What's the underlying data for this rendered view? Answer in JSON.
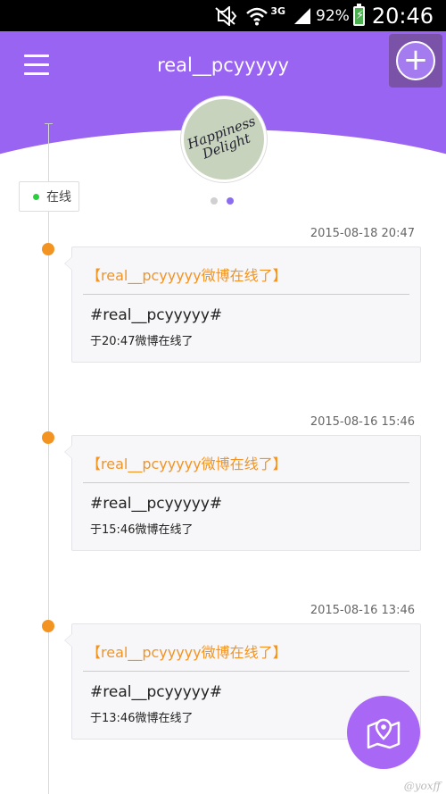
{
  "status_bar": {
    "network_type": "3G",
    "battery_percent": "92%",
    "time": "20:46"
  },
  "header": {
    "title": "real__pcyyyyy",
    "avatar_text": "Happiness Delight",
    "carousel": {
      "pages": 2,
      "active": 2
    }
  },
  "online_status": {
    "label": "在线",
    "color": "#2ecc40"
  },
  "timeline": {
    "entries": [
      {
        "timestamp": "2015-08-18 20:47",
        "title": "【real__pcyyyyy微博在线了】",
        "tag": "#real__pcyyyyy#",
        "body": "于20:47微博在线了"
      },
      {
        "timestamp": "2015-08-16 15:46",
        "title": "【real__pcyyyyy微博在线了】",
        "tag": "#real__pcyyyyy#",
        "body": "于15:46微博在线了"
      },
      {
        "timestamp": "2015-08-16 13:46",
        "title": "【real__pcyyyyy微博在线了】",
        "tag": "#real__pcyyyyy#",
        "body": "于13:46微博在线了"
      }
    ]
  },
  "watermark": "@yoxff",
  "colors": {
    "primary": "#9a64f2",
    "accent": "#f39422",
    "fab": "#a868f5",
    "dot_inactive": "#d0d0d0",
    "dot_active": "#8b6cf0"
  },
  "icons": {
    "menu": "hamburger-icon",
    "add": "plus-icon",
    "fab": "map-pin-icon"
  }
}
